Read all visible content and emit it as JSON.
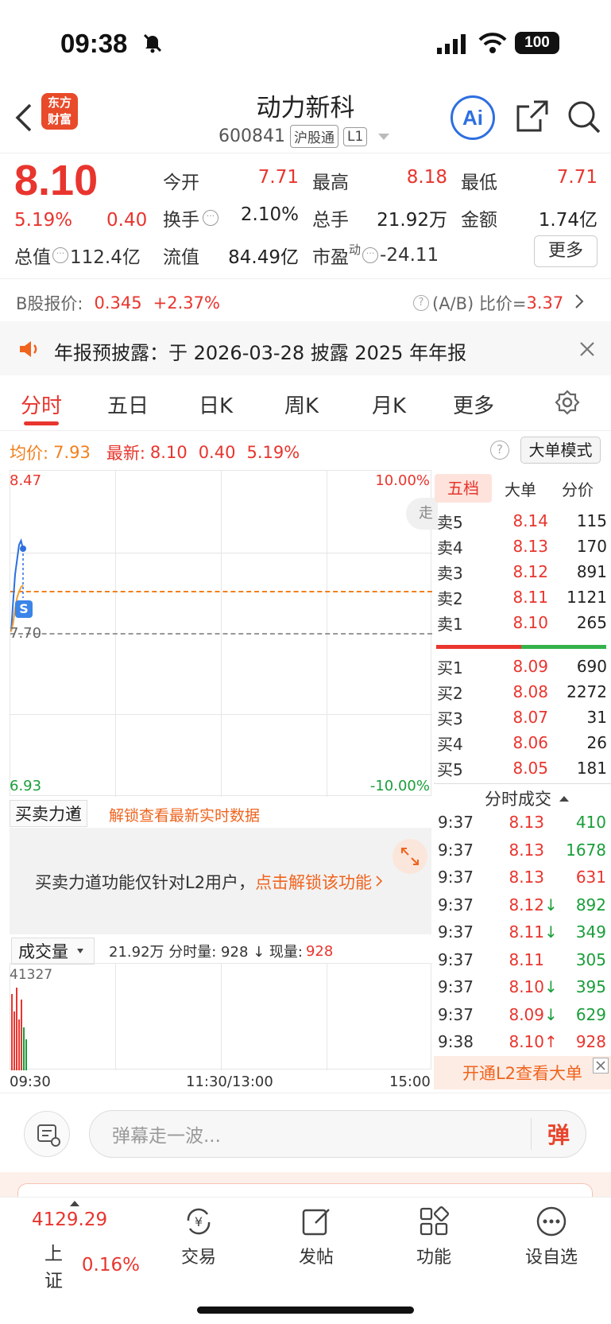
{
  "status_bar": {
    "time": "09:38",
    "battery": "100"
  },
  "header": {
    "brand_line1": "东方",
    "brand_line2": "财富",
    "title": "动力新科",
    "code": "600841",
    "tag1": "沪股通",
    "tag2": "L1",
    "ai_label": "Ai"
  },
  "quote": {
    "price": "8.10",
    "change_pct": "5.19%",
    "change": "0.40",
    "open_label": "今开",
    "open": "7.71",
    "high_label": "最高",
    "high": "8.18",
    "low_label": "最低",
    "low": "7.71",
    "turnover_label": "换手",
    "turnover": "2.10%",
    "volume_label": "总手",
    "volume": "21.92万",
    "amount_label": "金额",
    "amount": "1.74亿",
    "mktcap_label": "总值",
    "mktcap": "112.4亿",
    "float_label": "流值",
    "float": "84.49亿",
    "pe_label": "市盈",
    "pe_sup": "动",
    "pe": "-24.11",
    "more_button": "更多"
  },
  "bshare": {
    "label": "B股报价:",
    "price": "0.345",
    "change": "+2.37%",
    "ratio_label": "(A/B) 比价=",
    "ratio": "3.37"
  },
  "notice": {
    "text": "年报预披露：于 2026-03-28 披露 2025 年年报"
  },
  "tabs": [
    "分时",
    "五日",
    "日K",
    "周K",
    "月K",
    "更多"
  ],
  "intraday_info": {
    "avg_label": "均价:",
    "avg": "7.93",
    "latest_label": "最新:",
    "latest": "8.10",
    "chg": "0.40",
    "pct": "5.19%",
    "mode_button": "大单模式"
  },
  "chart_labels": {
    "y_top": "8.47",
    "y_mid": "7.70",
    "y_bottom": "6.93",
    "pct_top": "10.00%",
    "pct_bottom": "-10.00%",
    "side_tab": "走",
    "s_badge": "S"
  },
  "chart_data": {
    "type": "line",
    "ylim": [
      6.93,
      8.47
    ],
    "reference": 7.7,
    "series": [
      {
        "values": [
          7.71,
          7.85,
          7.98,
          8.05,
          8.12,
          8.14,
          8.1
        ]
      },
      {
        "values": [
          7.71,
          7.75,
          7.82,
          7.87,
          7.9,
          7.92,
          7.93
        ]
      }
    ]
  },
  "orderbook": {
    "tabs": [
      "五档",
      "大单",
      "分价"
    ],
    "asks": [
      {
        "label": "卖5",
        "price": "8.14",
        "vol": "115"
      },
      {
        "label": "卖4",
        "price": "8.13",
        "vol": "170"
      },
      {
        "label": "卖3",
        "price": "8.12",
        "vol": "891"
      },
      {
        "label": "卖2",
        "price": "8.11",
        "vol": "1121"
      },
      {
        "label": "卖1",
        "price": "8.10",
        "vol": "265"
      }
    ],
    "bids": [
      {
        "label": "买1",
        "price": "8.09",
        "vol": "690"
      },
      {
        "label": "买2",
        "price": "8.08",
        "vol": "2272"
      },
      {
        "label": "买3",
        "price": "8.07",
        "vol": "31"
      },
      {
        "label": "买4",
        "price": "8.06",
        "vol": "26"
      },
      {
        "label": "买5",
        "price": "8.05",
        "vol": "181"
      }
    ]
  },
  "trades": {
    "header": "分时成交",
    "rows": [
      {
        "time": "9:37",
        "price": "8.13",
        "arrow": "",
        "vol": "410",
        "color": "green"
      },
      {
        "time": "9:37",
        "price": "8.13",
        "arrow": "",
        "vol": "1678",
        "color": "green"
      },
      {
        "time": "9:37",
        "price": "8.13",
        "arrow": "",
        "vol": "631",
        "color": "red"
      },
      {
        "time": "9:37",
        "price": "8.12",
        "arrow": "↓",
        "vol": "892",
        "color": "green"
      },
      {
        "time": "9:37",
        "price": "8.11",
        "arrow": "↓",
        "vol": "349",
        "color": "green"
      },
      {
        "time": "9:37",
        "price": "8.11",
        "arrow": "",
        "vol": "305",
        "color": "green"
      },
      {
        "time": "9:37",
        "price": "8.10",
        "arrow": "↓",
        "vol": "395",
        "color": "green"
      },
      {
        "time": "9:37",
        "price": "8.09",
        "arrow": "↓",
        "vol": "629",
        "color": "green"
      },
      {
        "time": "9:38",
        "price": "8.10",
        "arrow": "↑",
        "vol": "928",
        "color": "red"
      }
    ],
    "unlock": "开通L2查看大单"
  },
  "force": {
    "selector": "买卖力道",
    "unlock_link": "解锁查看最新实时数据",
    "message": "买卖力道功能仅针对L2用户，",
    "message_link": "点击解锁该功能"
  },
  "volume": {
    "selector": "成交量",
    "summary": "21.92万 分时量: 928 ↓ 现量:",
    "current": "928",
    "max_label": "41327",
    "t_start": "09:30",
    "t_mid": "11:30/13:00",
    "t_end": "15:00"
  },
  "comment": {
    "placeholder": "弹幕走一波...",
    "send": "弹"
  },
  "bottom_nav": {
    "index_value": "4129.29",
    "index_name": "上证",
    "index_pct": "0.16%",
    "items": [
      "交易",
      "发帖",
      "功能",
      "设自选"
    ]
  },
  "colors": {
    "red": "#e8352e",
    "green": "#1a9e3a",
    "orange": "#f0801e",
    "blue": "#2d6fe0"
  }
}
